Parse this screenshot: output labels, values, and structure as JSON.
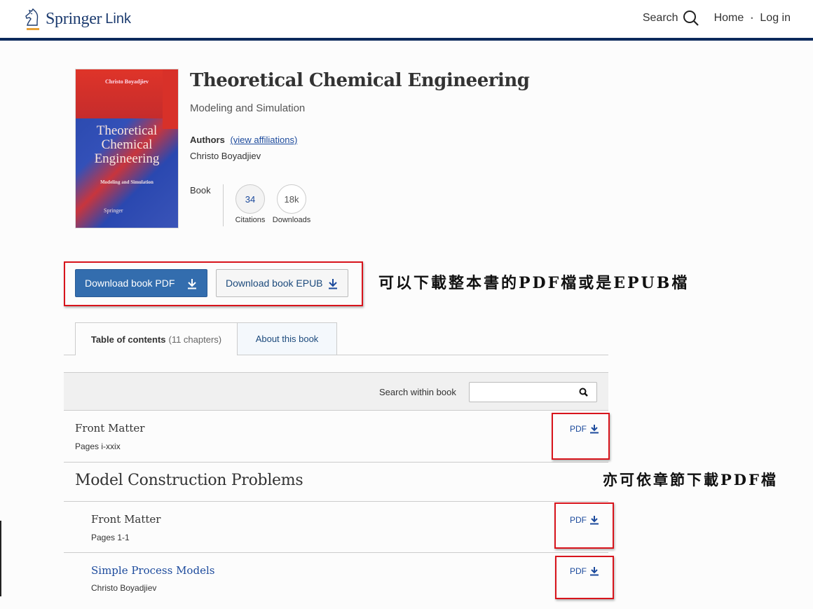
{
  "header": {
    "brand": "Springer",
    "brand_suffix": "Link",
    "nav": {
      "search_label": "Search",
      "home_label": "Home",
      "separator": "•",
      "login_label": "Log in"
    }
  },
  "book": {
    "cover": {
      "author": "Christo Boyadjiev",
      "title_lines": [
        "Theoretical",
        "Chemical",
        "Engineering"
      ],
      "subtitle": "Modeling and Simulation",
      "publisher": "Springer"
    },
    "title": "Theoretical Chemical Engineering",
    "subtitle": "Modeling and Simulation",
    "authors_label": "Authors",
    "affiliations_link": "(view affiliations)",
    "author": "Christo Boyadjiev",
    "type": "Book",
    "metrics": [
      {
        "value": "34",
        "label": "Citations"
      },
      {
        "value": "18k",
        "label": "Downloads"
      }
    ]
  },
  "downloads": {
    "pdf_label": "Download book PDF",
    "epub_label": "Download book EPUB"
  },
  "annotations": {
    "download_note": "可以下載整本書的PDF檔或是EPUB檔",
    "chapter_note": "亦可依章節下載PDF檔"
  },
  "tabs": {
    "toc_label": "Table of contents",
    "toc_count": "(11 chapters)",
    "about_label": "About this book"
  },
  "search": {
    "label": "Search within book",
    "value": "",
    "placeholder": ""
  },
  "toc": {
    "front_matter": {
      "title": "Front Matter",
      "pages": "Pages i-xxix",
      "pdf_label": "PDF"
    },
    "section": {
      "title": "Model Construction Problems",
      "items": [
        {
          "title": "Front Matter",
          "sub": "Pages 1-1",
          "pdf_label": "PDF"
        },
        {
          "title": "Simple Process Models",
          "sub": "Christo Boyadjiev",
          "pdf_label": "PDF"
        }
      ]
    }
  },
  "colors": {
    "brand_navy": "#0c2a5c",
    "primary_button": "#336dae",
    "link": "#1c4a9c",
    "annotation_red": "#d8141c",
    "logo_accent": "#e8a136"
  }
}
